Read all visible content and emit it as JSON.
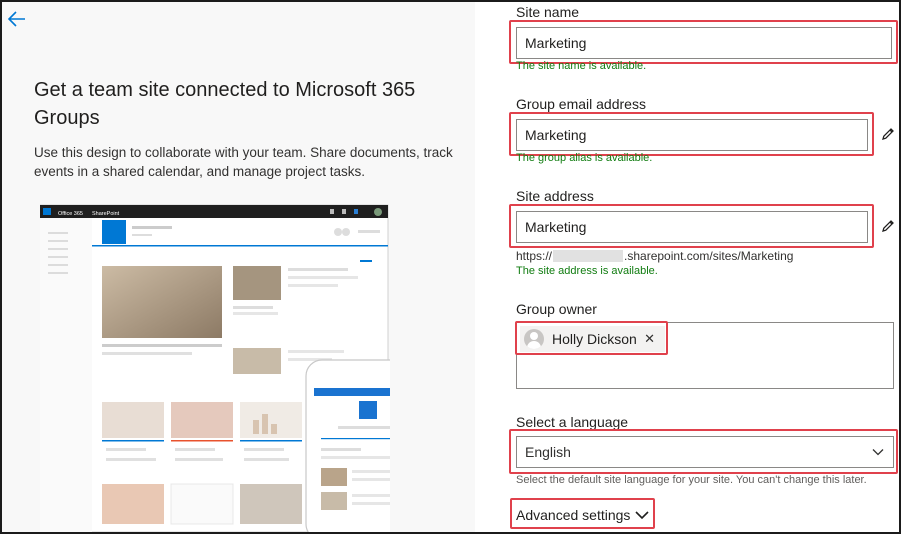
{
  "left": {
    "headline": "Get a team site connected to Microsoft 365 Groups",
    "description": "Use this design to collaborate with your team. Share documents, track events in a shared calendar, and manage project tasks.",
    "preview": {
      "app_name": "Office 365",
      "product_name": "SharePoint"
    }
  },
  "form": {
    "site_name": {
      "label": "Site name",
      "value": "Marketing",
      "status": "The site name is available."
    },
    "group_email": {
      "label": "Group email address",
      "value": "Marketing",
      "status": "The group alias is available."
    },
    "site_address": {
      "label": "Site address",
      "value": "Marketing",
      "url_prefix": "https://",
      "url_suffix": ".sharepoint.com/sites/Marketing",
      "status": "The site address is available."
    },
    "group_owner": {
      "label": "Group owner",
      "owner_name": "Holly Dickson",
      "remove_glyph": "✕"
    },
    "language": {
      "label": "Select a language",
      "value": "English",
      "hint": "Select the default site language for your site. You can't change this later."
    },
    "advanced_settings": {
      "label": "Advanced settings"
    }
  },
  "colors": {
    "accent": "#0078d4",
    "highlight": "#e0414c",
    "success": "#107c10"
  },
  "icons": {
    "back": "back-arrow-icon",
    "edit": "pencil-icon",
    "chevron": "chevron-down-icon"
  }
}
